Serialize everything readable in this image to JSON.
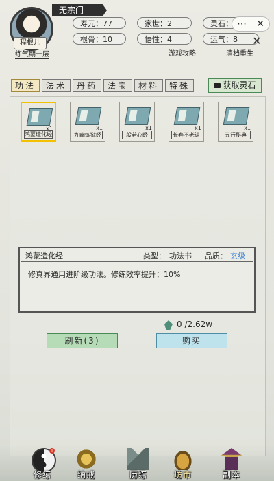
{
  "header": {
    "sect": "无宗门",
    "player_name": "程根儿",
    "realm": "练气期一层",
    "stats": {
      "lifespan": "寿元：77",
      "family": "家世：2",
      "spirit_stone": "灵石：0",
      "root_bone": "根骨：10",
      "comprehension": "悟性：4",
      "luck": "运气：8"
    },
    "guide_link": "游戏攻略",
    "reset_link": "清档重生"
  },
  "tabs": [
    {
      "label": "功法",
      "active": true
    },
    {
      "label": "法术",
      "active": false
    },
    {
      "label": "丹药",
      "active": false
    },
    {
      "label": "法宝",
      "active": false
    },
    {
      "label": "材料",
      "active": false
    },
    {
      "label": "特殊",
      "active": false
    }
  ],
  "get_spirit_stone_label": "获取灵石",
  "items": [
    {
      "name": "鸿蒙造化经",
      "qty": "x1",
      "selected": true
    },
    {
      "name": "九幽炼狱经",
      "qty": "x1",
      "selected": false
    },
    {
      "name": "般若心经",
      "qty": "x1",
      "selected": false
    },
    {
      "name": "长春不老诀",
      "qty": "x1",
      "selected": false
    },
    {
      "name": "五行秘典",
      "qty": "x1",
      "selected": false
    }
  ],
  "detail": {
    "title": "鸿蒙造化经",
    "type_label": "类型：",
    "type_value": "功法书",
    "quality_label": "品质：",
    "quality_value": "玄级",
    "description": "修真界通用进阶级功法。修练效率提升：10%"
  },
  "price": "0 /2.62w",
  "refresh_label": "刷新(3)",
  "buy_label": "购买",
  "nav": [
    {
      "label": "修练",
      "icon": "taiji-icon",
      "badge": "!",
      "active": false
    },
    {
      "label": "纳戒",
      "icon": "ring-icon",
      "badge": "",
      "active": false
    },
    {
      "label": "历练",
      "icon": "mountain-icon",
      "badge": "",
      "active": false
    },
    {
      "label": "坊市",
      "icon": "cauldron-icon",
      "badge": "",
      "active": true
    },
    {
      "label": "副本",
      "icon": "pagoda-icon",
      "badge": "",
      "active": false
    }
  ],
  "colors": {
    "tab_active": "#f3e8c2",
    "selected_border": "#f2c200",
    "refresh_button": "#b5dbb7",
    "buy_button": "#bfe3ec",
    "quality_text": "#3a7fd0"
  }
}
